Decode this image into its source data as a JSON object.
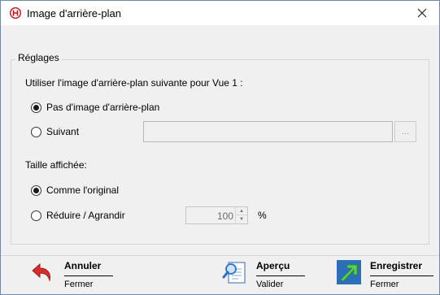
{
  "window": {
    "title": "Image d'arrière-plan",
    "icon": "app-logo-icon",
    "close_icon": "close-icon"
  },
  "settings": {
    "group_label": "Réglages",
    "background_prompt": "Utiliser l'image d'arrière-plan suivante pour Vue 1 :",
    "option_none": "Pas d'image d'arrière-plan",
    "option_next": "Suivant",
    "file_value": "",
    "browse_label": "...",
    "size_label": "Taille affichée:",
    "size_original": "Comme l'original",
    "size_scale": "Réduire / Agrandir",
    "scale_value": "100",
    "scale_unit": "%"
  },
  "selection": {
    "background": "none",
    "size": "original"
  },
  "actions": {
    "cancel": {
      "title": "Annuler",
      "subtitle": "Fermer",
      "icon": "undo-arrow-icon"
    },
    "preview": {
      "title": "Aperçu",
      "subtitle": "Valider",
      "icon": "preview-document-icon"
    },
    "save": {
      "title": "Enregistrer",
      "subtitle": "Fermer",
      "icon": "save-arrow-icon"
    }
  },
  "colors": {
    "cancel_red": "#d62d2d",
    "save_green": "#3aa33a",
    "preview_blue": "#2f6fc5",
    "logo_red": "#c0141b"
  }
}
